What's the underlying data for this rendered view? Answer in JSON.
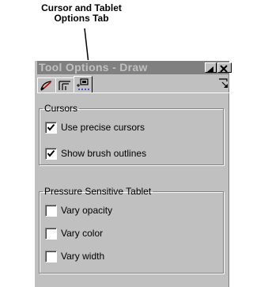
{
  "callout": {
    "line1": "Cursor and Tablet",
    "line2": "Options Tab"
  },
  "window": {
    "title": "Tool Options - Draw",
    "minimize_icon": "minimize-triangle",
    "close_icon": "close-x"
  },
  "tabs": [
    {
      "name": "draw-tool-tab",
      "icon": "brush-icon",
      "active": false
    },
    {
      "name": "tool-settings-tab",
      "icon": "settings-icon",
      "active": false
    },
    {
      "name": "cursor-tablet-tab",
      "icon": "cursor-tablet-icon",
      "active": true
    }
  ],
  "groups": {
    "cursors": {
      "label": "Cursors",
      "options": [
        {
          "label": "Use precise cursors",
          "checked": true
        },
        {
          "label": "Show brush outlines",
          "checked": true
        }
      ]
    },
    "tablet": {
      "label": "Pressure Sensitive Tablet",
      "options": [
        {
          "label": "Vary opacity",
          "checked": false
        },
        {
          "label": "Vary color",
          "checked": false
        },
        {
          "label": "Vary width",
          "checked": false
        }
      ]
    }
  }
}
